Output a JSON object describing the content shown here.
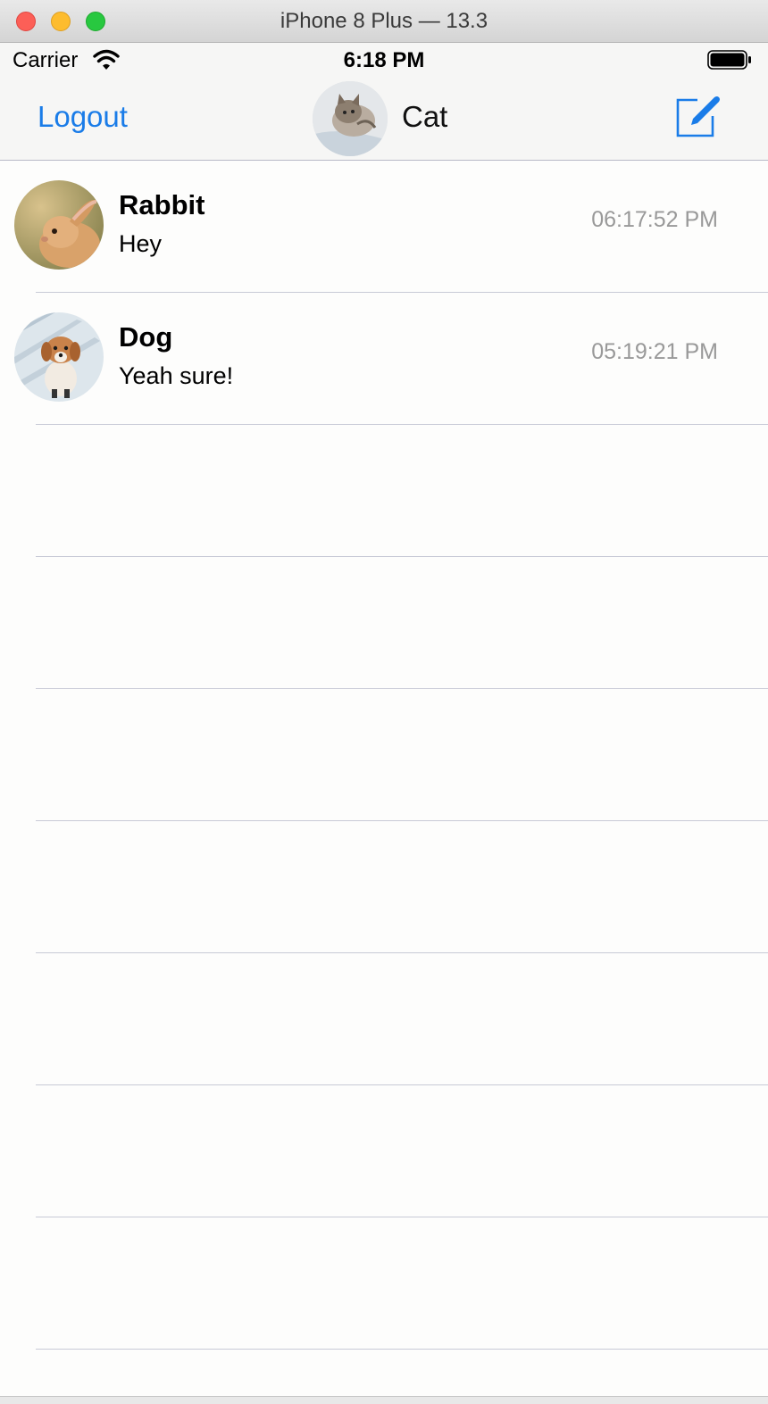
{
  "window": {
    "title": "iPhone 8 Plus — 13.3"
  },
  "status_bar": {
    "carrier": "Carrier",
    "time": "6:18 PM",
    "wifi_icon": "wifi-icon",
    "battery_icon": "battery-icon"
  },
  "nav": {
    "logout_label": "Logout",
    "title": "Cat",
    "compose_icon": "compose-icon",
    "accent": "#1a7ce8"
  },
  "conversations": [
    {
      "name": "Rabbit",
      "message": "Hey",
      "time": "06:17:52 PM",
      "avatar": "rabbit-avatar"
    },
    {
      "name": "Dog",
      "message": "Yeah sure!",
      "time": "05:19:21 PM",
      "avatar": "dog-avatar"
    }
  ],
  "colors": {
    "time_gray": "#999999",
    "separator": "#c8cad6"
  }
}
